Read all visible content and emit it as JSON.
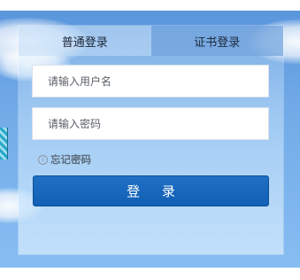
{
  "tabs": {
    "normal_login": "普通登录",
    "cert_login": "证书登录"
  },
  "form": {
    "username_placeholder": "请输入用户名",
    "password_placeholder": "请输入密码",
    "forgot_password": "忘记密码",
    "login_button": "登 录"
  },
  "colors": {
    "login_button": "#1565c0",
    "background_sky": "#73abe8"
  },
  "icons": {
    "forgot_password_icon": "info-circle-icon"
  }
}
